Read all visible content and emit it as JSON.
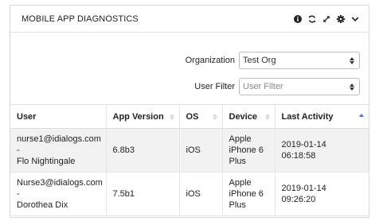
{
  "panel": {
    "title": "MOBILE APP DIAGNOSTICS",
    "tools": [
      "info-icon",
      "refresh-icon",
      "expand-icon",
      "gear-icon",
      "chevron-down-icon"
    ]
  },
  "filters": {
    "organization": {
      "label": "Organization",
      "value": "Test Org"
    },
    "user": {
      "label": "User Filter",
      "placeholder": "User Filter"
    }
  },
  "table": {
    "columns": [
      "User",
      "App Version",
      "OS",
      "Device",
      "Last Activity"
    ],
    "sorted_column": "Last Activity",
    "sort_direction": "ascending",
    "rows": [
      {
        "user": [
          "nurse1@idialogs.com -",
          "Flo Nightingale"
        ],
        "app_version": "6.8b3",
        "os": "iOS",
        "device": [
          "Apple",
          "iPhone 6",
          "Plus"
        ],
        "last_activity": [
          "2019-01-14",
          "06:18:58"
        ]
      },
      {
        "user": [
          "Nurse3@idialogs.com -",
          "Dorothea Dix"
        ],
        "app_version": "7.5b1",
        "os": "iOS",
        "device": [
          "Apple",
          "iPhone 6",
          "Plus"
        ],
        "last_activity": [
          "2019-01-14",
          "09:26:20"
        ]
      }
    ]
  },
  "colors": {
    "sort_active": "#4a6fdc",
    "row_stripe": "#f2f2f2",
    "border": "#d8d8d8"
  }
}
